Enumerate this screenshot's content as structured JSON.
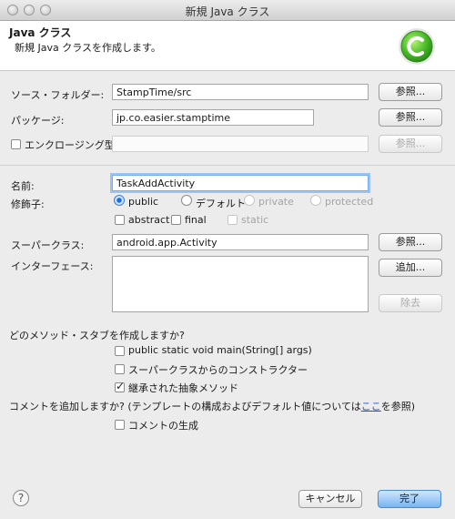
{
  "window": {
    "title": "新規 Java クラス"
  },
  "header": {
    "title": "Java クラス",
    "description": "新規 Java クラスを作成します。"
  },
  "source_folder": {
    "label": "ソース・フォルダー:",
    "value": "StampTime/src",
    "button": "参照..."
  },
  "package": {
    "label": "パッケージ:",
    "value": "jp.co.easier.stamptime",
    "button": "参照..."
  },
  "enclosing": {
    "label": "エンクロージング型:",
    "value": "",
    "button": "参照..."
  },
  "name": {
    "label": "名前:",
    "value": "TaskAddActivity"
  },
  "modifiers": {
    "label": "修飾子:",
    "public": "public",
    "default": "デフォルト",
    "private": "private",
    "protected": "protected",
    "abstract": "abstract",
    "final": "final",
    "static": "static"
  },
  "superclass": {
    "label": "スーパークラス:",
    "value": "android.app.Activity",
    "button": "参照..."
  },
  "interfaces": {
    "label": "インターフェース:",
    "add": "追加...",
    "remove": "除去"
  },
  "stubs": {
    "question": "どのメソッド・スタブを作成しますか?",
    "main": "public static void main(String[] args)",
    "constructors": "スーパークラスからのコンストラクター",
    "inherited": "継承された抽象メソッド"
  },
  "comments": {
    "question_prefix": "コメントを追加しますか? (テンプレートの構成およびデフォルト値については",
    "link": "ここ",
    "question_suffix": "を参照)",
    "generate": "コメントの生成"
  },
  "footer": {
    "cancel": "キャンセル",
    "finish": "完了"
  }
}
